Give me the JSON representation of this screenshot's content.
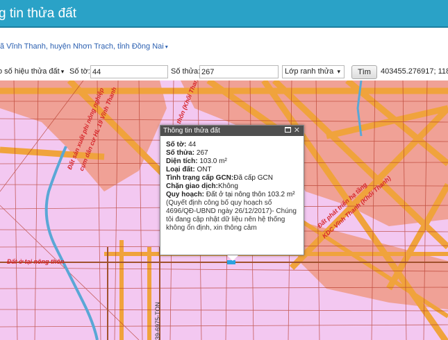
{
  "header": {
    "title": "g tin thửa đất"
  },
  "location": {
    "text": "ã Vĩnh Thanh, huyện Nhơn Trạch, tỉnh Đồng Nai",
    "caret": "▾"
  },
  "toolbar": {
    "mode_select": "o số hiệu thửa đất",
    "mode_arrow": "▾",
    "so_to_label": "Số tờ:",
    "so_to_value": "44",
    "so_thua_label": "Số thửa:",
    "so_thua_value": "267",
    "layer_select": "Lớp ranh thửa",
    "layer_arrow": "▾",
    "search_button": "Tìm",
    "coordinates": "403455.276917; 118"
  },
  "map": {
    "labels": {
      "dat_o_nong_thon": "Đất ở tại nông thôn",
      "dat_san_xuat": "Đất sản xuất",
      "dat_o_vinh_thanh": "Đất ở tại nông thôn",
      "dat_phat_trien": "Đất phát triển hạ tầng",
      "kdc_vinh_thanh": "KDC Vĩnh Thanh (Khối Thanh)",
      "road_code": "39-6975-TON",
      "top_label": "thôn (Khối Thanh)",
      "left_label_1": "Đất sản xuất phi nông nghiệp",
      "left_label_2": "cụm dân cư HL 19 Vĩnh Thanh"
    },
    "colors": {
      "base": "#f3c8f1",
      "residential": "#f0a196",
      "road": "#f0a33c",
      "boundary": "#b53a2a",
      "water": "#5aa7d6"
    }
  },
  "popup": {
    "title": "Thông tin thửa đất",
    "rows": [
      {
        "label": "Số tờ:",
        "value": " 44"
      },
      {
        "label": "Số thửa:",
        "value": " 267"
      },
      {
        "label": "Diện tích:",
        "value": " 103.0 m²"
      },
      {
        "label": "Loại đất:",
        "value": " ONT"
      },
      {
        "label": "Tình trạng cấp GCN:",
        "value": "Đã cấp GCN"
      },
      {
        "label": "Chặn giao dịch:",
        "value": "Không"
      }
    ],
    "quy_hoach_label": "Quy hoạch:",
    "quy_hoach_value": " Đất ở tại nông thôn 103.2 m²",
    "note": "(Quyết định công bố quy hoạch số 4696/QĐ-UBND ngày 26/12/2017)- Chúng tôi đang cập nhật dữ liệu nên hệ thống không ổn định, xin thông cảm"
  }
}
